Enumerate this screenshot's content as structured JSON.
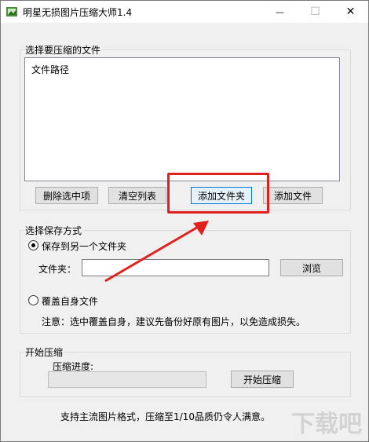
{
  "window": {
    "title": "明星无损图片压缩大师1.4",
    "minimize_glyph": "—",
    "maximize_glyph": "☐",
    "close_glyph": "✕"
  },
  "files_group": {
    "legend": "选择要压缩的文件",
    "list_header": "文件路径",
    "buttons": {
      "delete_selected": "删除选中项",
      "clear_list": "清空列表",
      "add_folder": "添加文件夹",
      "add_file": "添加文件"
    }
  },
  "save_group": {
    "legend": "选择保存方式",
    "option_other_folder": "保存到另一个文件夹",
    "option_other_folder_selected": true,
    "folder_label": "文件夹：",
    "folder_value": "",
    "browse_button": "浏览",
    "option_overwrite": "覆盖自身文件",
    "option_overwrite_selected": false,
    "note": "注意：选中覆盖自身，建议先备份好原有图片，以免造成损失。"
  },
  "compress_group": {
    "legend": "开始压缩",
    "progress_label": "压缩进度:",
    "progress_value": 0,
    "start_button": "开始压缩"
  },
  "footer": {
    "text": "支持主流图片格式，压缩至1/10品质仍令人满意。"
  },
  "annotation": {
    "highlight_color": "#e0201c"
  },
  "watermark": {
    "text": "下载吧"
  }
}
